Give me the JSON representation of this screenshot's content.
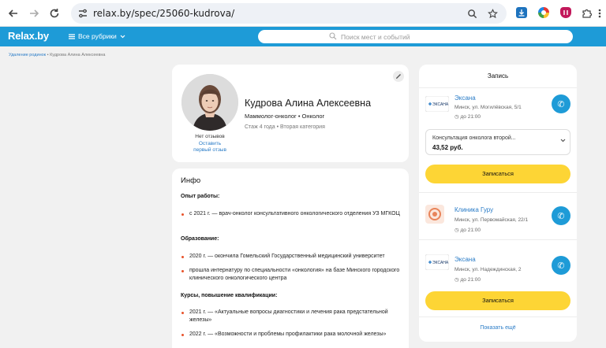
{
  "browser": {
    "url": "relax.by/spec/25060-kudrova/"
  },
  "site": {
    "logo": "Relax.by",
    "rubrics_label": "Все рубрики",
    "search_placeholder": "Поиск мест и событий"
  },
  "breadcrumb": {
    "link": "Удаление родинок",
    "current": "Кудрова Алина Алексеевна"
  },
  "profile": {
    "name": "Кудрова Алина Алексеевна",
    "specialty": "Маммолог-онколог • Онколог",
    "experience": "Стаж 4 года",
    "category": "Вторая категория",
    "no_reviews": "Нет отзывов",
    "leave_review": "Оставить первый отзыв"
  },
  "info": {
    "title": "Инфо",
    "work_title": "Опыт работы:",
    "work_items": [
      "с 2021 г. — врач-онколог консультативного онкологического отделения УЗ МГКОЦ"
    ],
    "edu_title": "Образование:",
    "edu_items": [
      "2020 г. — окончила Гомельский Государственный медицинский университет",
      "прошла интернатуру по специальности «онкология» на базе Минского городского клинического онкологического центра"
    ],
    "courses_title": "Курсы, повышение квалификации:",
    "course_items": [
      "2021 г. — «Актуальные вопросы диагностики и лечения рака предстательной железы»",
      "2022 г. — «Возможности и проблемы профилактики рака молочной железы»"
    ]
  },
  "booking": {
    "title": "Запись",
    "clinics": [
      {
        "name": "Эксана",
        "address": "Минск, ул. Могилёвская, 5/1",
        "time": "до 21:00",
        "logo_text": "ЭКСАНА"
      },
      {
        "name": "Клиника Гуру",
        "address": "Минск, ул. Первомайская, 22/1",
        "time": "до 21:00"
      },
      {
        "name": "Эксана",
        "address": "Минск, ул. Надеждинская, 2",
        "time": "до 21:00",
        "logo_text": "ЭКСАНА"
      }
    ],
    "service": "Консультация онколога второй...",
    "price": "43,52 руб.",
    "book_label": "Записаться",
    "show_more": "Показать ещё"
  },
  "colors": {
    "brand_blue": "#1e9bd7",
    "button_yellow": "#fdd535",
    "bullet_orange": "#e8522a"
  }
}
